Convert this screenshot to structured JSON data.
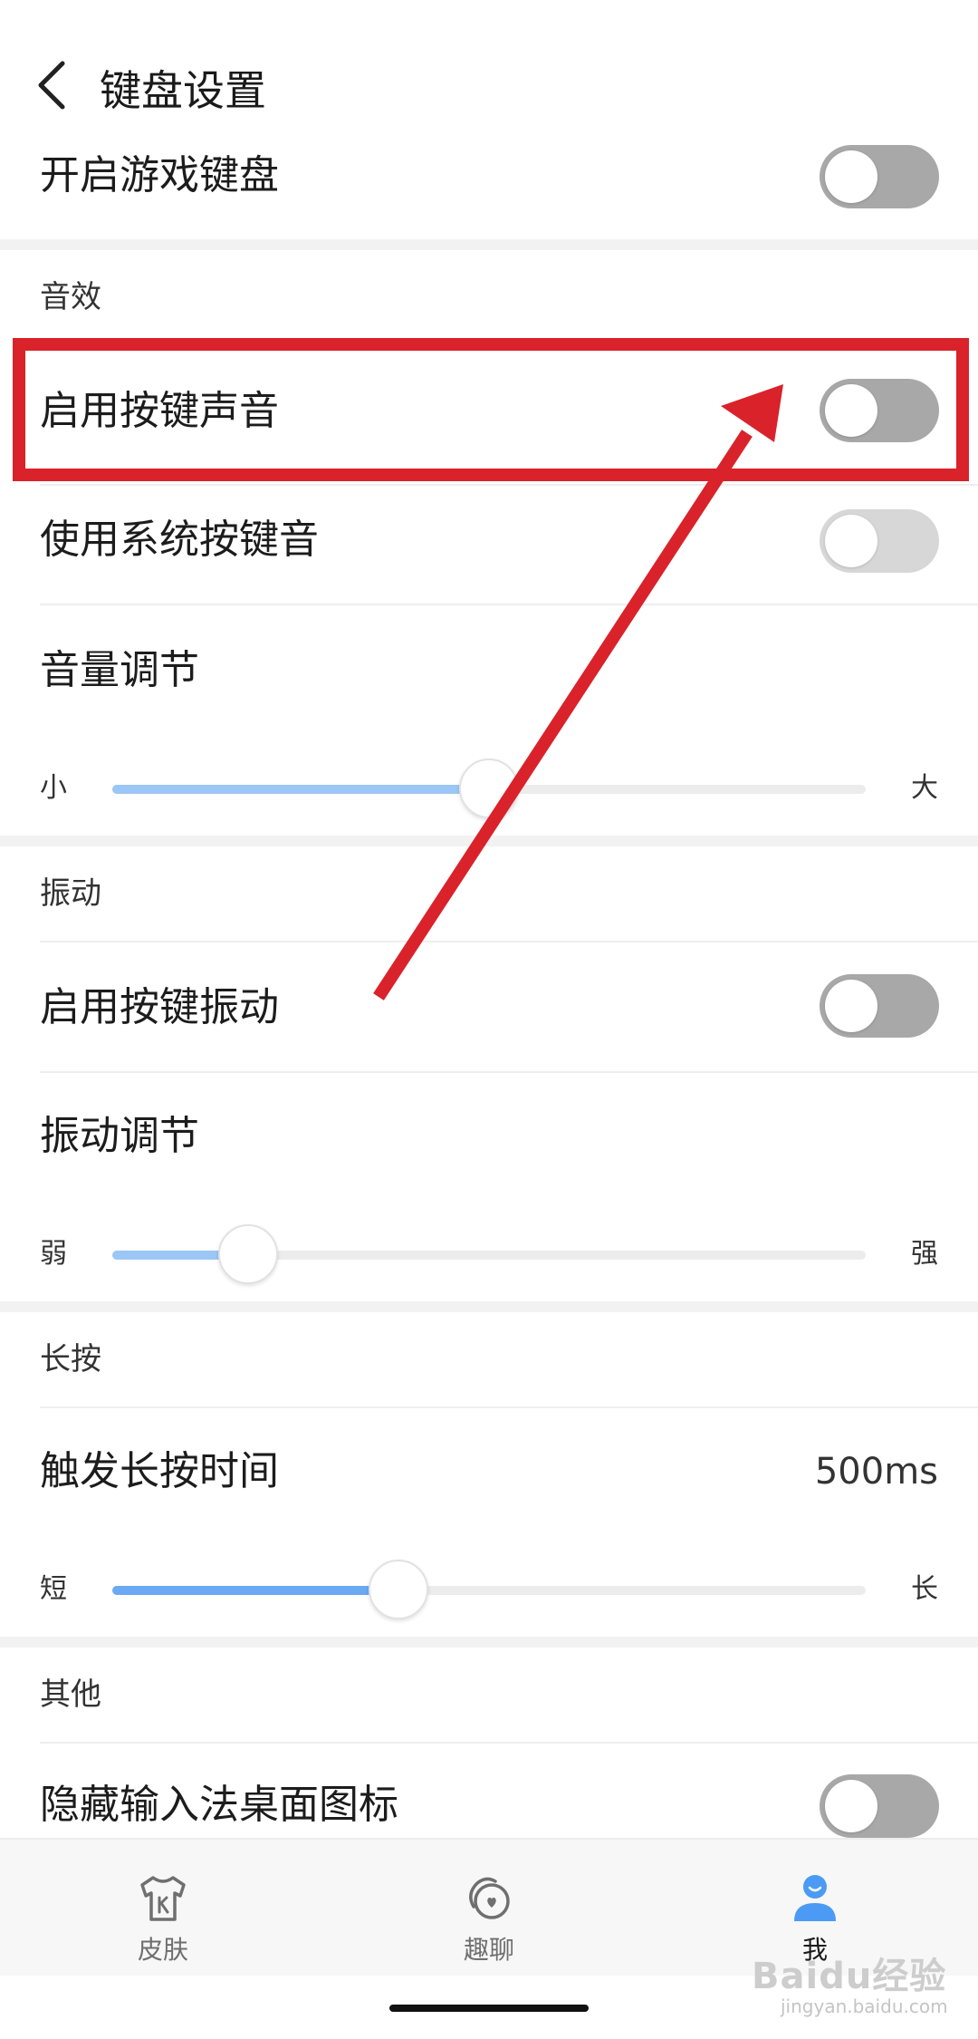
{
  "header": {
    "title": "键盘设置"
  },
  "rows": {
    "game_keyboard": "开启游戏键盘",
    "sound_section": "音效",
    "key_sound": "启用按键声音",
    "system_key_sound": "使用系统按键音",
    "volume": "音量调节",
    "vibration_section": "振动",
    "key_vibration": "启用按键振动",
    "vibration_adjust": "振动调节",
    "longpress_section": "长按",
    "longpress_time": "触发长按时间",
    "longpress_value": "500ms",
    "other_section": "其他",
    "hide_icon": "隐藏输入法桌面图标"
  },
  "sliders": {
    "volume": {
      "min_label": "小",
      "max_label": "大",
      "value": 0.5
    },
    "vibration": {
      "min_label": "弱",
      "max_label": "强",
      "value": 0.18
    },
    "longpress": {
      "min_label": "短",
      "max_label": "长",
      "value": 0.38
    }
  },
  "toggles": {
    "game_keyboard": false,
    "key_sound": false,
    "system_key_sound": false,
    "key_vibration": false,
    "hide_icon": false
  },
  "tabs": [
    {
      "label": "皮肤",
      "icon": "tshirt-icon"
    },
    {
      "label": "趣聊",
      "icon": "chat-bubble-icon"
    },
    {
      "label": "我",
      "icon": "user-icon"
    }
  ],
  "watermark": {
    "main": "Baidu经验",
    "sub": "jingyan.baidu.com"
  },
  "colors": {
    "accent": "#2f8cff",
    "annotation": "#d9222a"
  }
}
